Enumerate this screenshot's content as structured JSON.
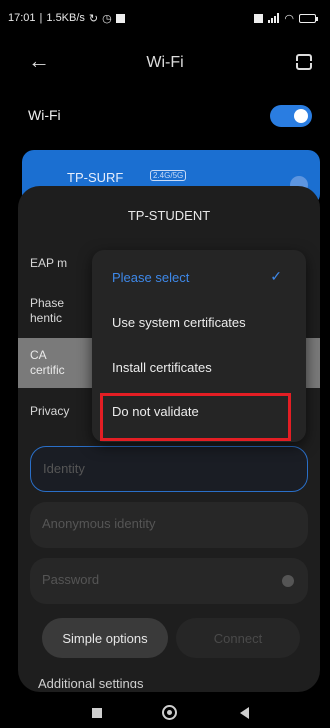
{
  "status_bar": {
    "time": "17:01",
    "speed": "1.5KB/s",
    "battery_level": "full"
  },
  "header": {
    "title": "Wi-Fi",
    "back_icon": "arrow-left-icon",
    "scan_icon": "qr-scan-icon"
  },
  "wifi": {
    "label": "Wi-Fi",
    "enabled": true
  },
  "network": {
    "name": "TP-SURF",
    "band_tag": "2.4G/5G"
  },
  "dialog": {
    "title": "TP-STUDENT",
    "labels": {
      "eap": "EAP m",
      "phase_line1": "Phase",
      "phase_line2": "hentic",
      "ca_line1": "CA",
      "ca_line2": "certific",
      "privacy": "Privacy"
    },
    "identity_placeholder": "Identity",
    "anonymous_placeholder": "Anonymous identity",
    "password_placeholder": "Password",
    "simple_options": "Simple options",
    "connect": "Connect",
    "additional": "Additional settings"
  },
  "dropdown": {
    "items": [
      {
        "label": "Please select",
        "selected": true
      },
      {
        "label": "Use system certificates",
        "selected": false
      },
      {
        "label": "Install certificates",
        "selected": false
      },
      {
        "label": "Do not validate",
        "selected": false
      }
    ]
  },
  "colors": {
    "accent": "#1b6fd1",
    "highlight": "#e31e24"
  }
}
